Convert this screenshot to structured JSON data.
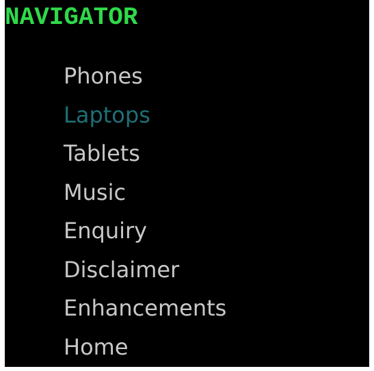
{
  "navigator": {
    "title": "NAVIGATOR",
    "colors": {
      "title": "#2fd94a",
      "link": "#c8c8c8",
      "active_link": "#1f6f75",
      "background": "#000000"
    },
    "active_index": 1,
    "items": [
      {
        "label": "Phones"
      },
      {
        "label": "Laptops"
      },
      {
        "label": "Tablets"
      },
      {
        "label": "Music"
      },
      {
        "label": "Enquiry"
      },
      {
        "label": "Disclaimer"
      },
      {
        "label": "Enhancements"
      },
      {
        "label": "Home"
      }
    ]
  }
}
